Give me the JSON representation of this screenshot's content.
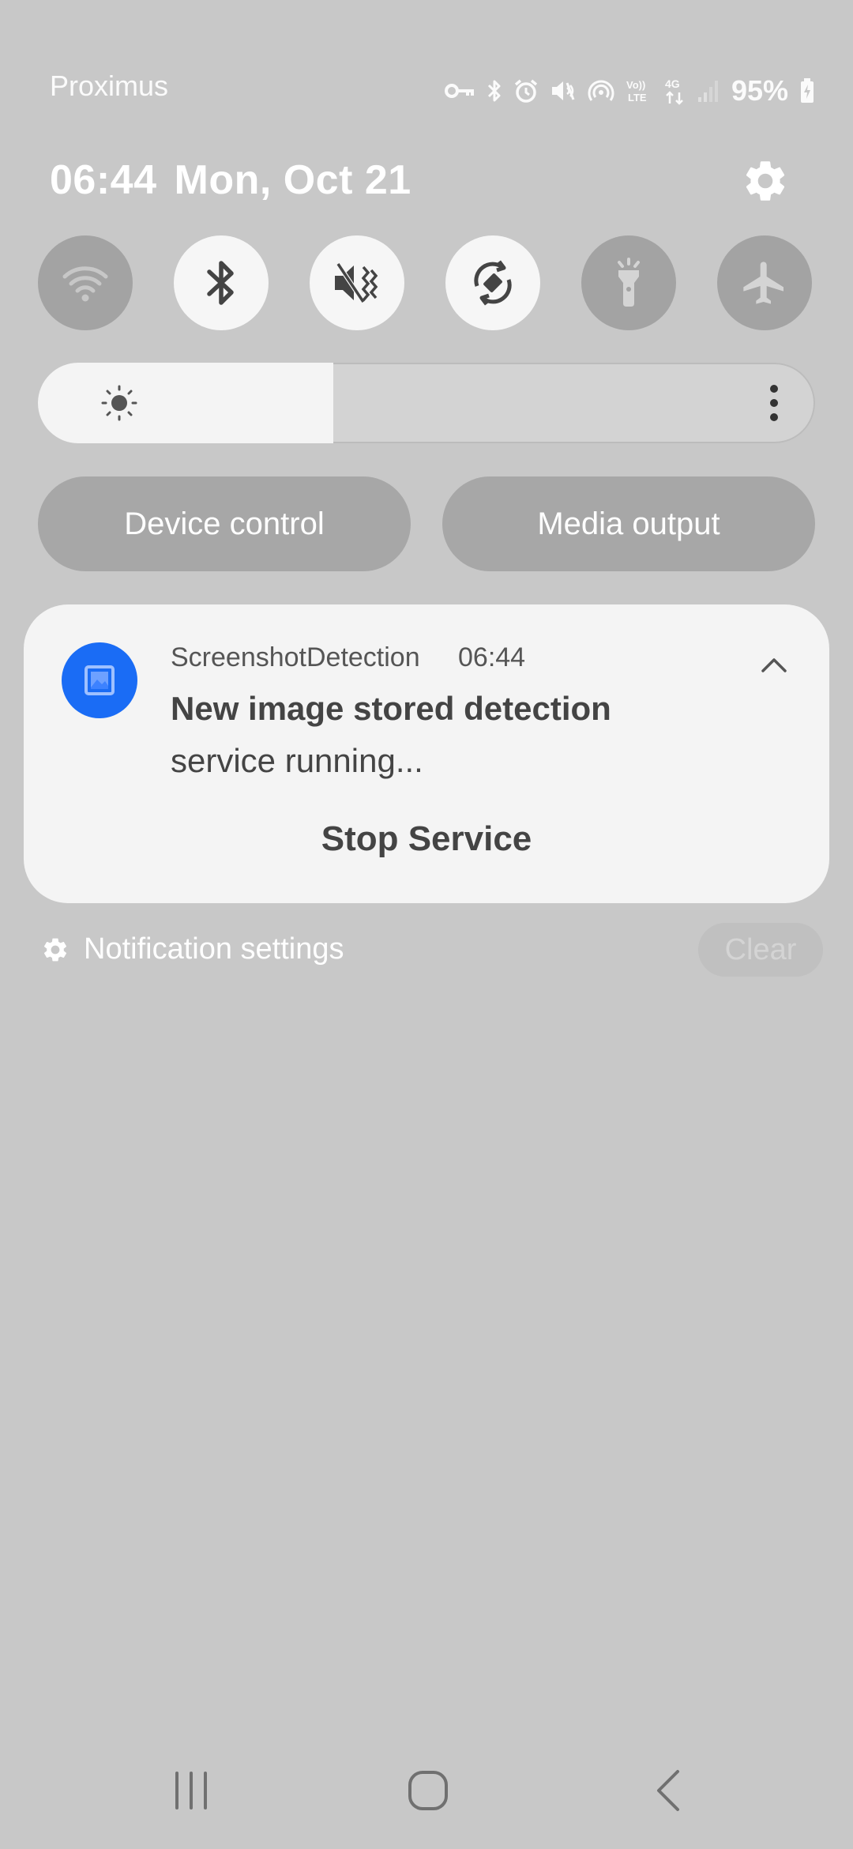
{
  "status_bar": {
    "carrier": "Proximus",
    "icons": [
      "vpn-key-icon",
      "bluetooth-icon",
      "alarm-icon",
      "mute-icon",
      "hotspot-icon",
      "volte-icon",
      "4g-data-icon",
      "signal-icon",
      "battery-charging-icon"
    ],
    "volte_label": "Vo)) LTE",
    "network_label": "4G",
    "battery": "95%"
  },
  "header": {
    "time": "06:44",
    "date": "Mon, Oct 21"
  },
  "quick_toggles": [
    {
      "name": "wifi",
      "icon": "wifi-icon",
      "on": false
    },
    {
      "name": "bluetooth",
      "icon": "bluetooth-icon",
      "on": true
    },
    {
      "name": "mute",
      "icon": "mute-icon",
      "on": true
    },
    {
      "name": "auto-rotate",
      "icon": "auto-rotate-icon",
      "on": true
    },
    {
      "name": "flashlight",
      "icon": "flashlight-icon",
      "on": false
    },
    {
      "name": "airplane-mode",
      "icon": "airplane-icon",
      "on": false
    }
  ],
  "brightness": {
    "level": 0.38
  },
  "buttons": {
    "device_control": "Device control",
    "media_output": "Media output"
  },
  "notification": {
    "app_name": "ScreenshotDetection",
    "time": "06:44",
    "title": "New image stored detection",
    "text": "service running...",
    "action": "Stop Service",
    "app_color": "#1a6cf5"
  },
  "footer": {
    "settings_label": "Notification settings",
    "clear_label": "Clear"
  },
  "nav": {
    "icons": [
      "recent-apps-icon",
      "home-icon",
      "back-icon"
    ]
  }
}
